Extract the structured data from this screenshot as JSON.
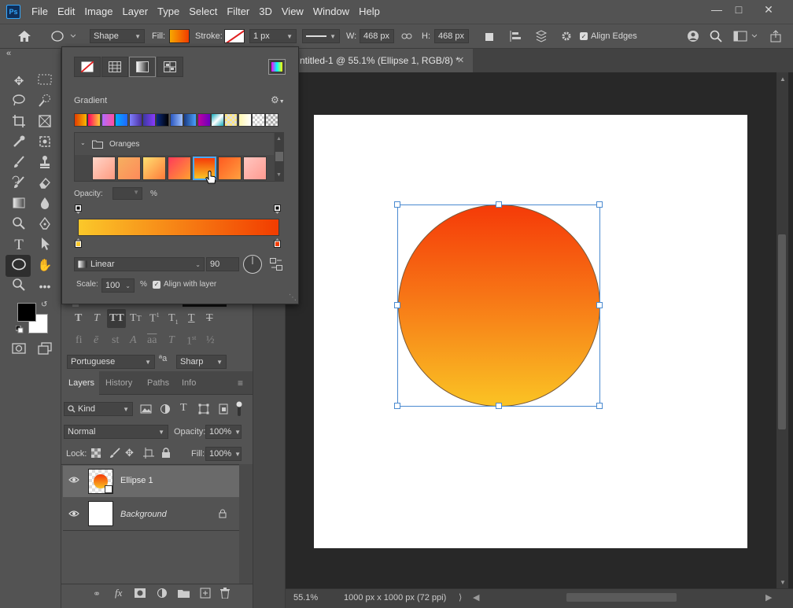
{
  "app": {
    "logo": "Ps",
    "menu": [
      "File",
      "Edit",
      "Image",
      "Layer",
      "Type",
      "Select",
      "Filter",
      "3D",
      "View",
      "Window",
      "Help"
    ],
    "window_controls": [
      "minimize",
      "maximize",
      "close"
    ]
  },
  "options_bar": {
    "tool_mode": "Shape",
    "fill_label": "Fill:",
    "stroke_label": "Stroke:",
    "stroke_width": "1 px",
    "w_label": "W:",
    "w_value": "468 px",
    "h_label": "H:",
    "h_value": "468 px",
    "align_edges_label": "Align Edges",
    "fill_color_start": "#f7a800",
    "fill_color_end": "#f23c00"
  },
  "document": {
    "tab_title": "ntitled-1 @ 55.1% (Ellipse 1, RGB/8) *",
    "zoom": "55.1%",
    "doc_info": "1000 px x 1000 px (72 ppi)"
  },
  "gradient_popup": {
    "section_title": "Gradient",
    "folder_name": "Oranges",
    "opacity_label": "Opacity:",
    "opacity_unit": "%",
    "style": "Linear",
    "angle": "90",
    "scale_label": "Scale:",
    "scale_value": "100",
    "scale_unit": "%",
    "align_with_layer_label": "Align with layer",
    "gradient_start": "#fbc82a",
    "gradient_end": "#f23c00"
  },
  "character_panel": {
    "language": "Portuguese",
    "aa_label": "ªa",
    "antialias": "Sharp"
  },
  "layers_panel": {
    "tabs": [
      "Layers",
      "History",
      "Paths",
      "Info"
    ],
    "filter_kind": "Kind",
    "blend_mode": "Normal",
    "opacity_label": "Opacity:",
    "opacity_value": "100%",
    "lock_label": "Lock:",
    "fill_label": "Fill:",
    "fill_value": "100%",
    "layers": [
      {
        "name": "Ellipse 1",
        "selected": true
      },
      {
        "name": "Background",
        "locked": true
      }
    ]
  },
  "colors": {
    "foreground": "#000000",
    "background": "#ffffff",
    "ellipse_top": "#f53a08",
    "ellipse_bottom": "#fac324"
  }
}
